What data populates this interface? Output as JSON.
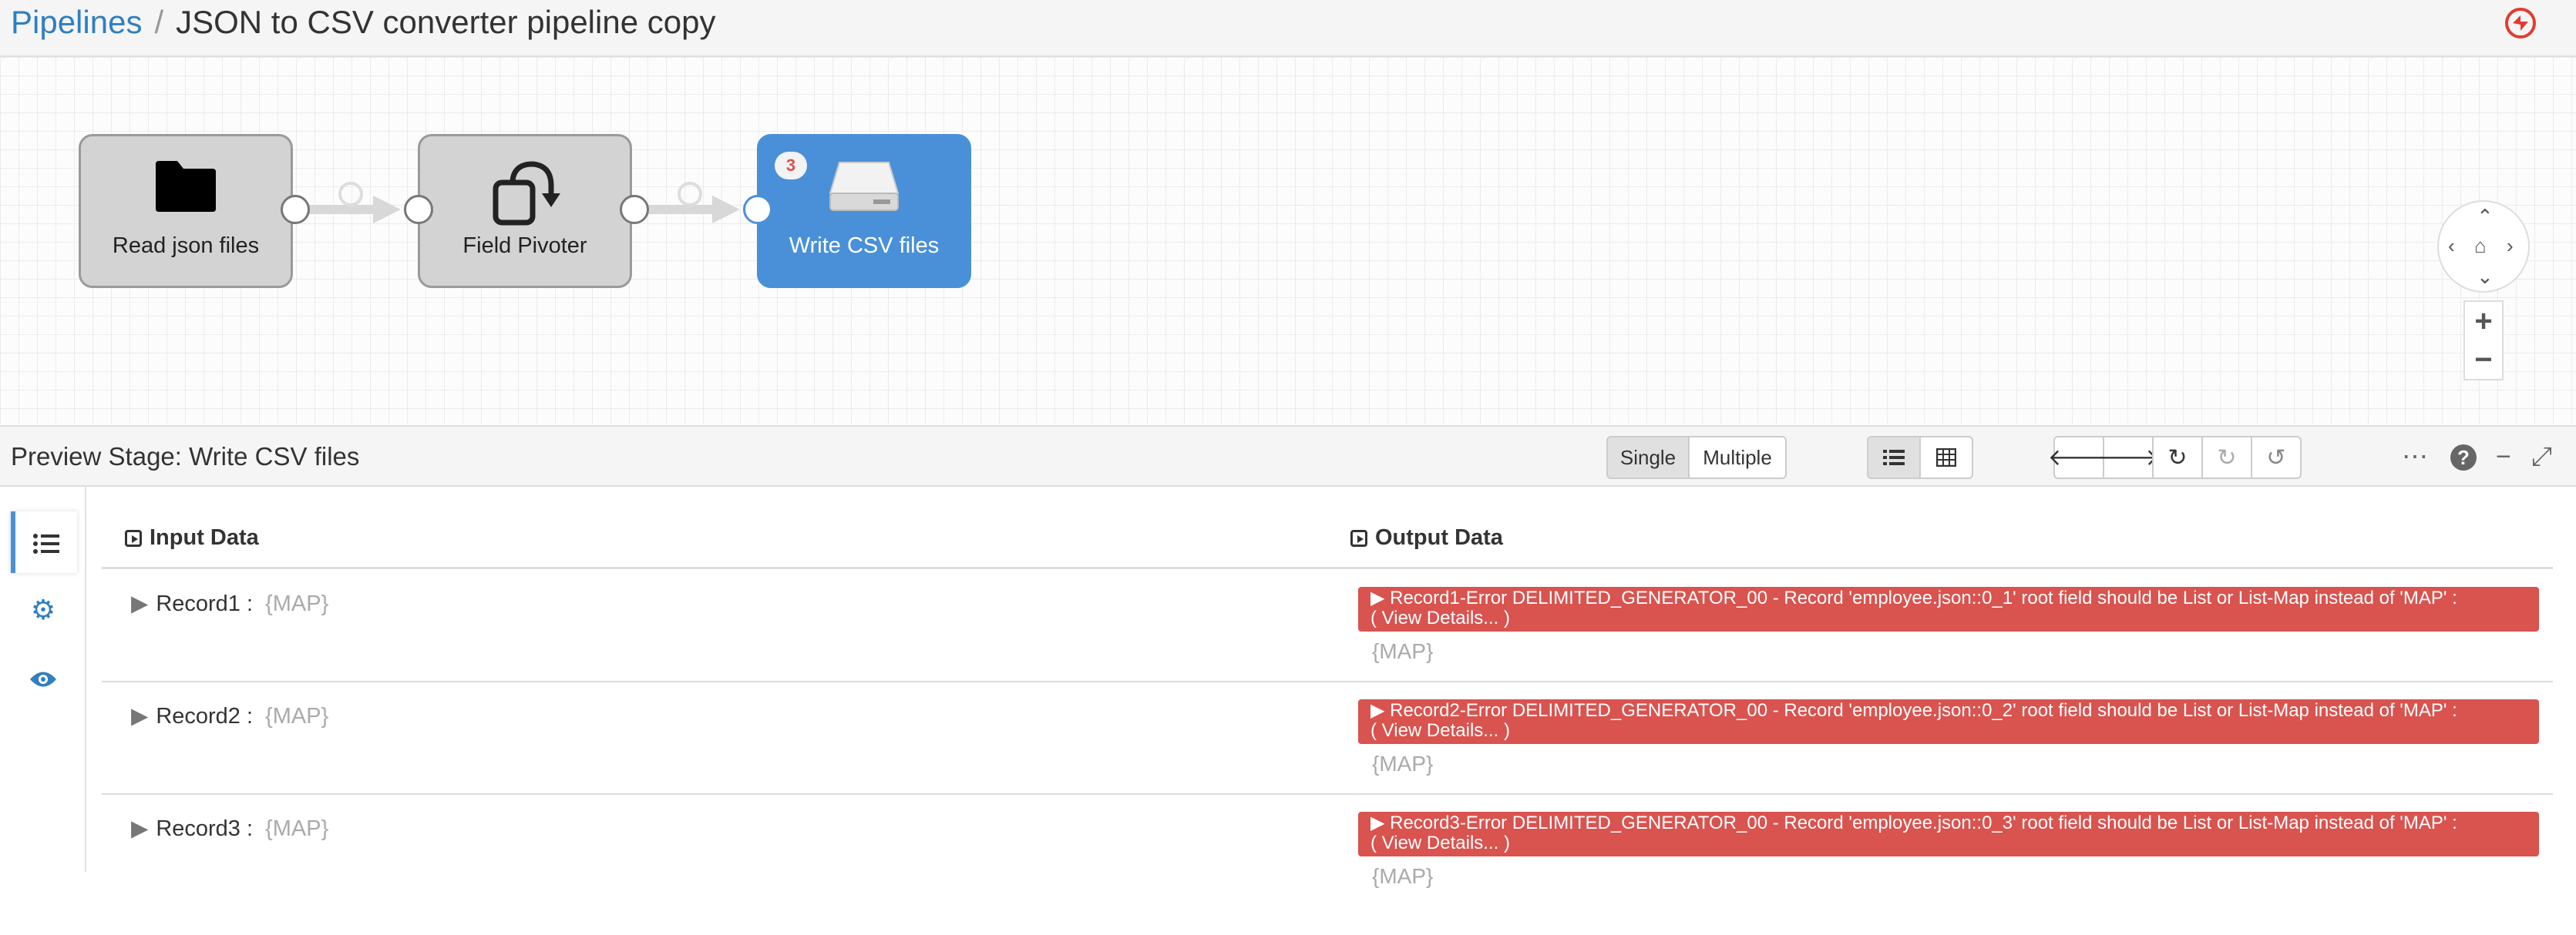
{
  "breadcrumb": {
    "root": "Pipelines",
    "separator": "/",
    "title": "JSON to CSV converter pipeline copy"
  },
  "logo_icon": "streamsets-logo-icon",
  "stages": [
    {
      "label": "Read json files",
      "icon": "folder-icon"
    },
    {
      "label": "Field Pivoter",
      "icon": "pivot-icon"
    },
    {
      "label": "Write CSV files",
      "icon": "disk-icon",
      "badge": "3"
    }
  ],
  "preview": {
    "title": "Preview Stage: Write CSV files",
    "single_label": "Single",
    "multiple_label": "Multiple"
  },
  "columns": {
    "input": "Input Data",
    "output": "Output Data"
  },
  "records": [
    {
      "name": "Record1 :",
      "input_value": "{MAP}",
      "error_line1": "▶ Record1-Error DELIMITED_GENERATOR_00 - Record 'employee.json::0_1' root field should be List or List-Map instead of 'MAP' :",
      "error_line2": "( View Details... )",
      "output_value": "{MAP}"
    },
    {
      "name": "Record2 :",
      "input_value": "{MAP}",
      "error_line1": "▶ Record2-Error DELIMITED_GENERATOR_00 - Record 'employee.json::0_2' root field should be List or List-Map instead of 'MAP' :",
      "error_line2": "( View Details... )",
      "output_value": "{MAP}"
    },
    {
      "name": "Record3 :",
      "input_value": "{MAP}",
      "error_line1": "▶ Record3-Error DELIMITED_GENERATOR_00 - Record 'employee.json::0_3' root field should be List or List-Map instead of 'MAP' :",
      "error_line2": "( View Details... )",
      "output_value": "{MAP}"
    }
  ],
  "colors": {
    "link": "#2f7fc1",
    "active_stage": "#4a90d9",
    "error": "#d9534f"
  }
}
